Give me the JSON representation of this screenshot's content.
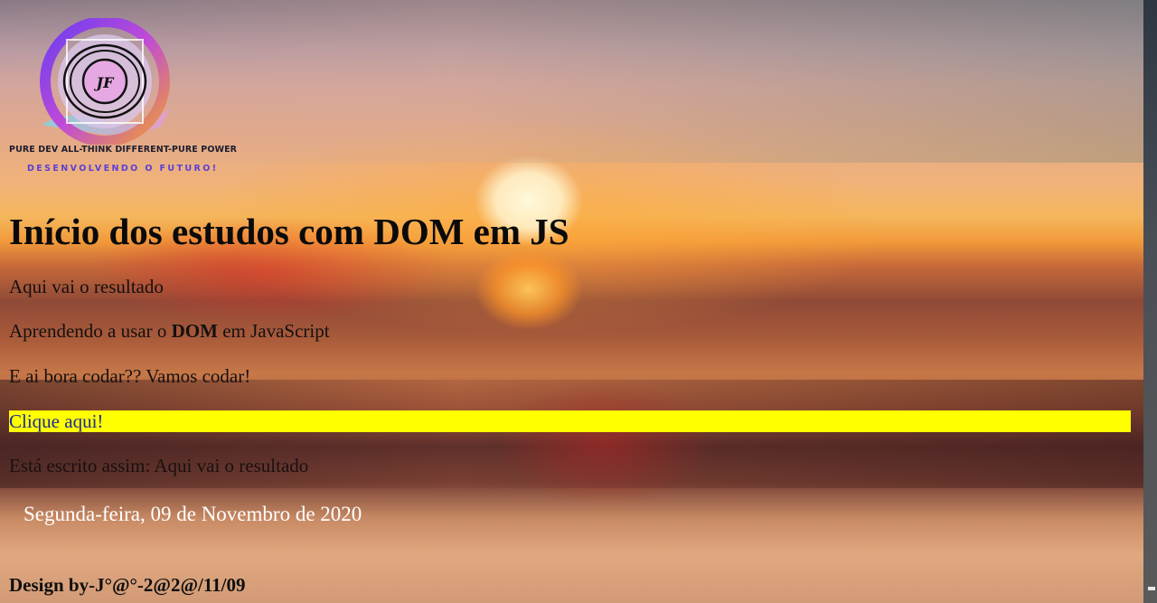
{
  "logo": {
    "initials": "JF",
    "tagline": "PURE DEV ALL-THINK DIFFERENT-PURE POWER",
    "subtitle": "DESENVOLVENDO O FUTURO!"
  },
  "heading": "Início dos estudos com DOM em JS",
  "paragraphs": {
    "result": "Aqui vai o resultado",
    "learning_prefix": "Aprendendo a usar o ",
    "learning_bold": "DOM",
    "learning_suffix": " em JavaScript",
    "cta": "E ai bora codar?? Vamos codar!"
  },
  "click_button": {
    "label": "Clique aqui!",
    "background": "#ffff00",
    "text_color": "#1c2a9a"
  },
  "written": "Está escrito assim: Aqui vai o resultado",
  "date": "Segunda-feira, 09 de Novembro de 2020",
  "footer": "Design by-J°@°-2@2@/11/09"
}
